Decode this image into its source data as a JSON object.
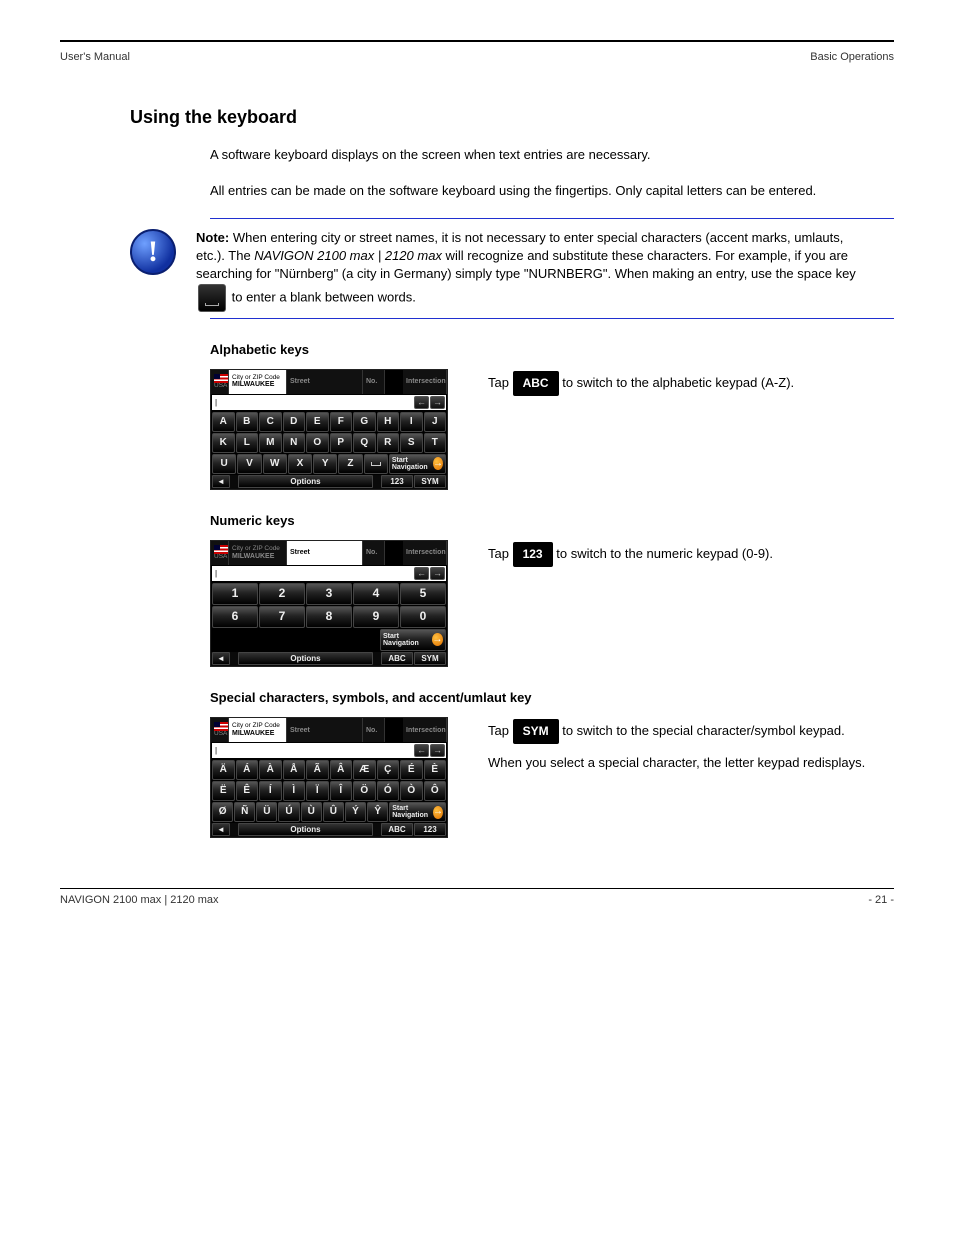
{
  "header": {
    "left": "User's Manual",
    "right": "Basic Operations"
  },
  "footer": {
    "left": "NAVIGON 2100 max | 2120 max",
    "right": "- 21 -"
  },
  "s1": {
    "title": "Using the keyboard",
    "p1": "A software keyboard displays on the screen when text entries are necessary.",
    "p2": "All entries can be made on the software keyboard using the fingertips. Only capital letters can be entered.",
    "note_b": "Note:",
    "note_t1": "When entering city or street names, it is not necessary to enter special characters (accent marks, umlauts, etc.). The ",
    "note_mid": "NAVIGON 2100 max | 2120 max",
    "note_t2": " will recognize and substitute these characters. For example, if you are searching for \"Nürnberg\" (a city in Germany) simply type \"NURNBERG\". When making an entry, use the space key ",
    "note_t3": " to enter a blank between words.",
    "alpha": {
      "h": "Alphabetic keys",
      "desc_pre": "Tap ",
      "key": "ABC",
      "desc_post": " to switch to the alphabetic keypad (A-Z)."
    },
    "num": {
      "h": "Numeric keys",
      "desc_pre": "Tap ",
      "key": "123",
      "desc_post": " to switch to the numeric keypad (0-9)."
    },
    "sym": {
      "h": "Special characters, symbols, and accent/umlaut key",
      "desc_pre": "Tap ",
      "key": "SYM",
      "desc_post": " to switch to the special character/symbol keypad.",
      "desc_p2": "When you select a special character, the letter keypad redisplays."
    }
  },
  "kbd": {
    "tabs": {
      "city_l1": "City or ZIP Code",
      "city_l2": "MILWAUKEE",
      "street": "Street",
      "no": "No.",
      "inter": "Intersection",
      "usa": "USA"
    },
    "nav": {
      "back": "←",
      "fwd": "→"
    },
    "start": "Start Navigation",
    "options": "Options",
    "modes": {
      "abc": "ABC",
      "num": "123",
      "sym": "SYM"
    },
    "alphaRows": [
      [
        "A",
        "B",
        "C",
        "D",
        "E",
        "F",
        "G",
        "H",
        "I",
        "J"
      ],
      [
        "K",
        "L",
        "M",
        "N",
        "O",
        "P",
        "Q",
        "R",
        "S",
        "T"
      ],
      [
        "U",
        "V",
        "W",
        "X",
        "Y",
        "Z"
      ]
    ],
    "numRows": [
      [
        "1",
        "2",
        "3",
        "4",
        "5"
      ],
      [
        "6",
        "7",
        "8",
        "9",
        "0"
      ]
    ],
    "symRows": [
      [
        "Ä",
        "Á",
        "À",
        "Å",
        "Ã",
        "Â",
        "Æ",
        "Ç",
        "É",
        "È"
      ],
      [
        "Ë",
        "Ê",
        "Í",
        "Ì",
        "Ï",
        "Î",
        "Ö",
        "Ó",
        "Ò",
        "Ô"
      ],
      [
        "Ø",
        "Ñ",
        "Ü",
        "Ú",
        "Ù",
        "Û",
        "Ý",
        "Ŷ"
      ]
    ]
  }
}
